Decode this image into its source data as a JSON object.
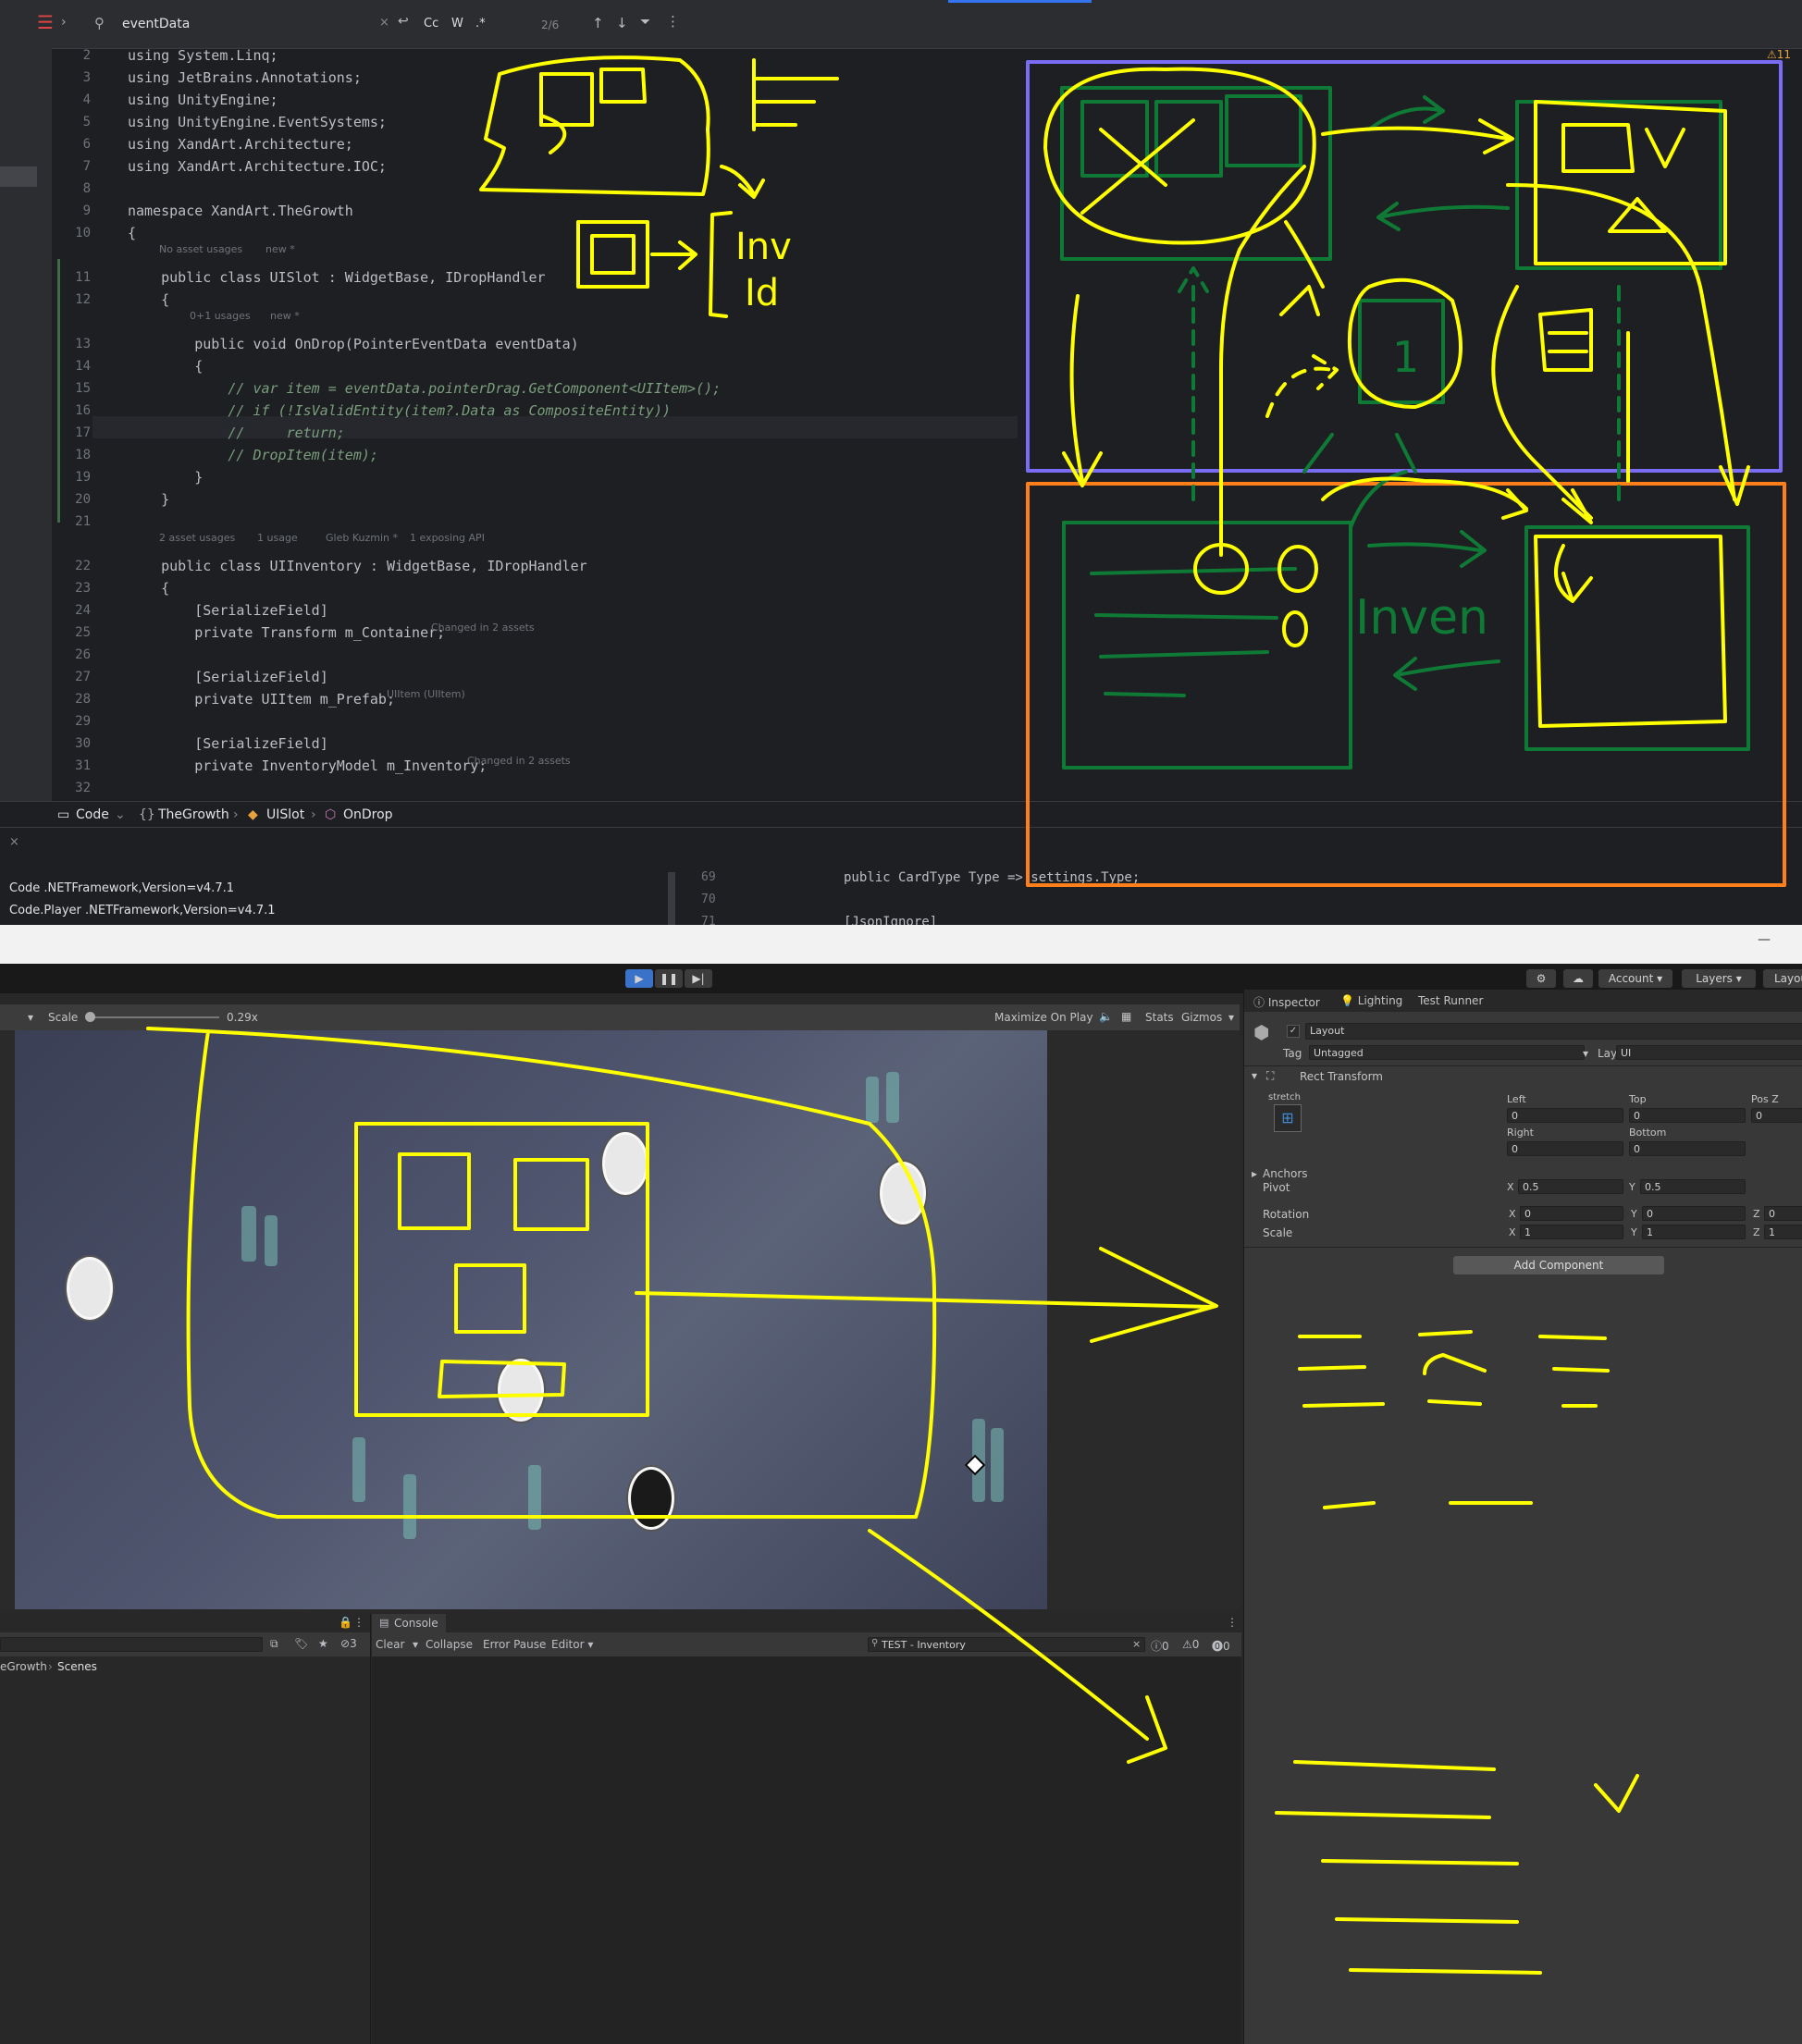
{
  "ide": {
    "search": {
      "query": "eventData",
      "match_count": "2/6",
      "case_label": "Cc",
      "word_label": "W",
      "regex_label": ".*"
    },
    "warnings_badge": "11",
    "lines": [
      {
        "n": "2",
        "text": "using System.Linq;"
      },
      {
        "n": "3",
        "text": "using JetBrains.Annotations;"
      },
      {
        "n": "4",
        "text": "using UnityEngine;"
      },
      {
        "n": "5",
        "text": "using UnityEngine.EventSystems;"
      },
      {
        "n": "6",
        "text": "using XandArt.Architecture;"
      },
      {
        "n": "7",
        "text": "using XandArt.Architecture.IOC;"
      },
      {
        "n": "8",
        "text": ""
      },
      {
        "n": "9",
        "text": "namespace XandArt.TheGrowth"
      },
      {
        "n": "10",
        "text": "{"
      },
      {
        "n": "11",
        "text": "    public class UISlot : WidgetBase, IDropHandler"
      },
      {
        "n": "12",
        "text": "    {"
      },
      {
        "n": "13",
        "text": "        public void OnDrop(PointerEventData eventData)"
      },
      {
        "n": "14",
        "text": "        {"
      },
      {
        "n": "15",
        "text": "            // var item = eventData.pointerDrag.GetComponent<UIItem>();"
      },
      {
        "n": "16",
        "text": "            // if (!IsValidEntity(item?.Data as CompositeEntity))"
      },
      {
        "n": "17",
        "text": "            //     return;"
      },
      {
        "n": "18",
        "text": "            // DropItem(item);"
      },
      {
        "n": "19",
        "text": "        }"
      },
      {
        "n": "20",
        "text": "    }"
      },
      {
        "n": "21",
        "text": ""
      },
      {
        "n": "22",
        "text": "    public class UIInventory : WidgetBase, IDropHandler"
      },
      {
        "n": "23",
        "text": "    {"
      },
      {
        "n": "24",
        "text": "        [SerializeField]"
      },
      {
        "n": "25",
        "text": "        private Transform m_Container;"
      },
      {
        "n": "26",
        "text": ""
      },
      {
        "n": "27",
        "text": "        [SerializeField]"
      },
      {
        "n": "28",
        "text": "        private UIItem m_Prefab;"
      },
      {
        "n": "29",
        "text": ""
      },
      {
        "n": "30",
        "text": "        [SerializeField]"
      },
      {
        "n": "31",
        "text": "        private InventoryModel m_Inventory;"
      },
      {
        "n": "32",
        "text": ""
      }
    ],
    "hints": {
      "slot_usages": "No asset usages",
      "slot_new": "new *",
      "drop_usages": "0+1 usages",
      "drop_new": "new *",
      "inv_usages": "2 asset usages",
      "inv_usage": "1 usage",
      "inv_author": "Gleb Kuzmin *",
      "inv_api": "1 exposing API",
      "container_changed": "Changed in 2 assets",
      "prefab_hint": "UIItem (UIItem)",
      "inventory_changed": "Changed in 2 assets"
    },
    "breadcrumb": [
      "Code",
      "TheGrowth",
      "UISlot",
      "OnDrop"
    ],
    "bottom": {
      "projects": [
        "Code .NETFramework,Version=v4.7.1",
        "Code.Player .NETFramework,Version=v4.7.1"
      ],
      "line_numbers": [
        "69",
        "70",
        "71"
      ],
      "code_line": "public CardType Type => settings.Type;",
      "code_line2": "[JsonIgnore]"
    },
    "sketch_text": {
      "inv": "Inv",
      "id": "Id",
      "inven": "Inven",
      "one": "1"
    }
  },
  "unity": {
    "toolbar": {
      "account": "Account",
      "layers": "Layers",
      "layout": "Layou"
    },
    "game_bar": {
      "scale_label": "Scale",
      "scale_value": "0.29x",
      "maximize": "Maximize On Play",
      "stats": "Stats",
      "gizmos": "Gizmos"
    },
    "inspector": {
      "tabs": [
        "Inspector",
        "Lighting",
        "Test Runner"
      ],
      "object_name": "Layout",
      "tag_label": "Tag",
      "tag_value": "Untagged",
      "layer_label": "Layer",
      "layer_value": "UI",
      "component": "Rect Transform",
      "stretch": "stretch",
      "left_label": "Left",
      "top_label": "Top",
      "posz_label": "Pos Z",
      "left": "0",
      "top": "0",
      "posz": "0",
      "right_label": "Right",
      "bottom_label": "Bottom",
      "right": "0",
      "bottom": "0",
      "anchors": "Anchors",
      "pivot": "Pivot",
      "pivot_x": "0.5",
      "pivot_y": "0.5",
      "rotation": "Rotation",
      "rot_x": "0",
      "rot_y": "0",
      "rot_z": "0",
      "scale": "Scale",
      "scale_x": "1",
      "scale_y": "1",
      "scale_z": "1",
      "x": "X",
      "y": "Y",
      "z": "Z",
      "add_component": "Add Component"
    },
    "project": {
      "breadcrumb_a": "eGrowth",
      "breadcrumb_b": "Scenes",
      "hidden_count": "3"
    },
    "console": {
      "tab": "Console",
      "clear": "Clear",
      "collapse": "Collapse",
      "error_pause": "Error Pause",
      "editor": "Editor",
      "search_value": "TEST - Inventory",
      "log_count": "0",
      "warn_count": "0",
      "err_count": "0"
    }
  },
  "colors": {
    "sketch_yellow": "#ffff00",
    "sketch_green": "#0f7a35",
    "box_blue": "#7b6cf6",
    "box_orange": "#ff7f1a",
    "ide_bg": "#1e1f22"
  }
}
